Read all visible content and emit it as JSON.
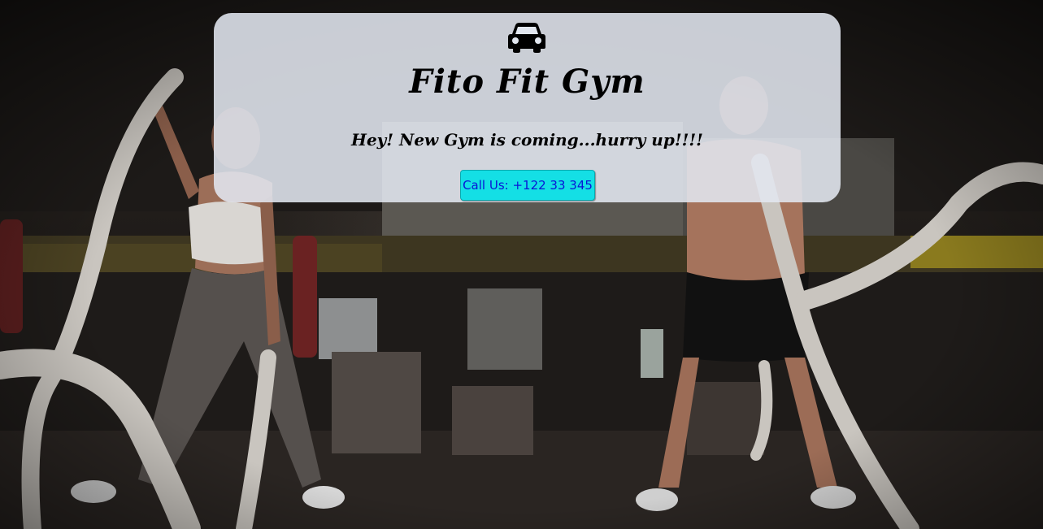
{
  "hero": {
    "icon": "car-icon",
    "title": "Fito Fit Gym",
    "tagline": "Hey! New Gym is coming...hurry up!!!!",
    "call_button_label": "Call Us: +122 33 345"
  },
  "background": {
    "subject": "gym-battle-ropes-photo"
  },
  "colors": {
    "card_background": "#e2e7f0",
    "button_background": "#14dfe5",
    "button_text": "#0a16d6",
    "title_text": "#000000"
  }
}
